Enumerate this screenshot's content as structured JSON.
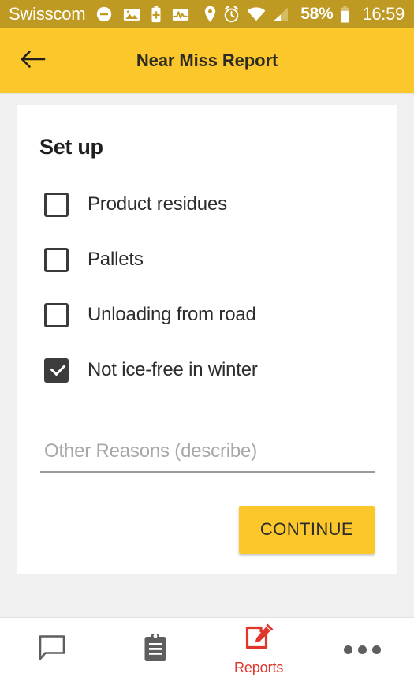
{
  "status_bar": {
    "carrier": "Swisscom",
    "battery_percent": "58%",
    "time": "16:59",
    "background_color": "#bf9a22",
    "text_color": "#ffffff",
    "icons_left": [
      "do-not-disturb-icon",
      "image-icon",
      "battery-plus-icon",
      "activity-pulse-icon"
    ],
    "icons_right": [
      "location-pin-icon",
      "alarm-clock-icon",
      "wifi-icon",
      "cellular-signal-icon",
      "battery-icon"
    ]
  },
  "app_bar": {
    "title": "Near Miss Report",
    "back_icon": "arrow-left-icon",
    "background_color": "#fbc72b",
    "title_color": "#2e2b24"
  },
  "card": {
    "title": "Set up",
    "checkboxes": [
      {
        "label": "Product residues",
        "checked": false
      },
      {
        "label": "Pallets",
        "checked": false
      },
      {
        "label": "Unloading from road",
        "checked": false
      },
      {
        "label": "Not ice-free in winter",
        "checked": true
      }
    ],
    "other_reasons": {
      "placeholder": "Other Reasons (describe)",
      "value": ""
    },
    "continue_label": "CONTINUE",
    "continue_color": "#fbc72b"
  },
  "bottom_nav": {
    "active_color": "#e0352b",
    "inactive_color": "#5e5e5e",
    "items": [
      {
        "label": "",
        "icon": "chat-bubble-icon",
        "active": false
      },
      {
        "label": "",
        "icon": "clipboard-icon",
        "active": false
      },
      {
        "label": "Reports",
        "icon": "edit-document-icon",
        "active": true
      },
      {
        "label": "",
        "icon": "more-horizontal-icon",
        "active": false
      }
    ]
  }
}
